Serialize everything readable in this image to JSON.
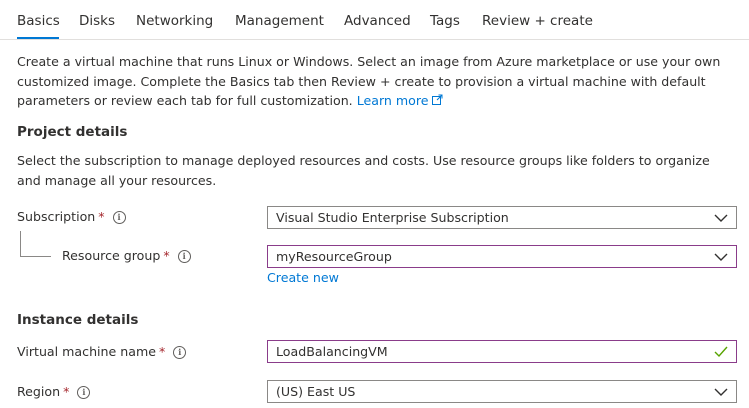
{
  "tabs": [
    {
      "label": "Basics",
      "active": true
    },
    {
      "label": "Disks",
      "active": false
    },
    {
      "label": "Networking",
      "active": false
    },
    {
      "label": "Management",
      "active": false
    },
    {
      "label": "Advanced",
      "active": false
    },
    {
      "label": "Tags",
      "active": false
    },
    {
      "label": "Review + create",
      "active": false
    }
  ],
  "intro": {
    "text": "Create a virtual machine that runs Linux or Windows. Select an image from Azure marketplace or use your own customized image. Complete the Basics tab then Review + create to provision a virtual machine with default parameters or review each tab for full customization.",
    "learn_more": "Learn more"
  },
  "project": {
    "title": "Project details",
    "description": "Select the subscription to manage deployed resources and costs. Use resource groups like folders to organize and manage all your resources.",
    "subscription_label": "Subscription",
    "subscription_value": "Visual Studio Enterprise Subscription",
    "resource_group_label": "Resource group",
    "resource_group_value": "myResourceGroup",
    "create_new": "Create new"
  },
  "instance": {
    "title": "Instance details",
    "vm_name_label": "Virtual machine name",
    "vm_name_value": "LoadBalancingVM",
    "region_label": "Region",
    "region_value": "(US) East US"
  },
  "required_marker": "*",
  "info_glyph": "i",
  "colors": {
    "accent": "#0078d4",
    "required": "#a4262c",
    "focus_border": "#8a3c8a",
    "valid_check": "#57a300"
  }
}
